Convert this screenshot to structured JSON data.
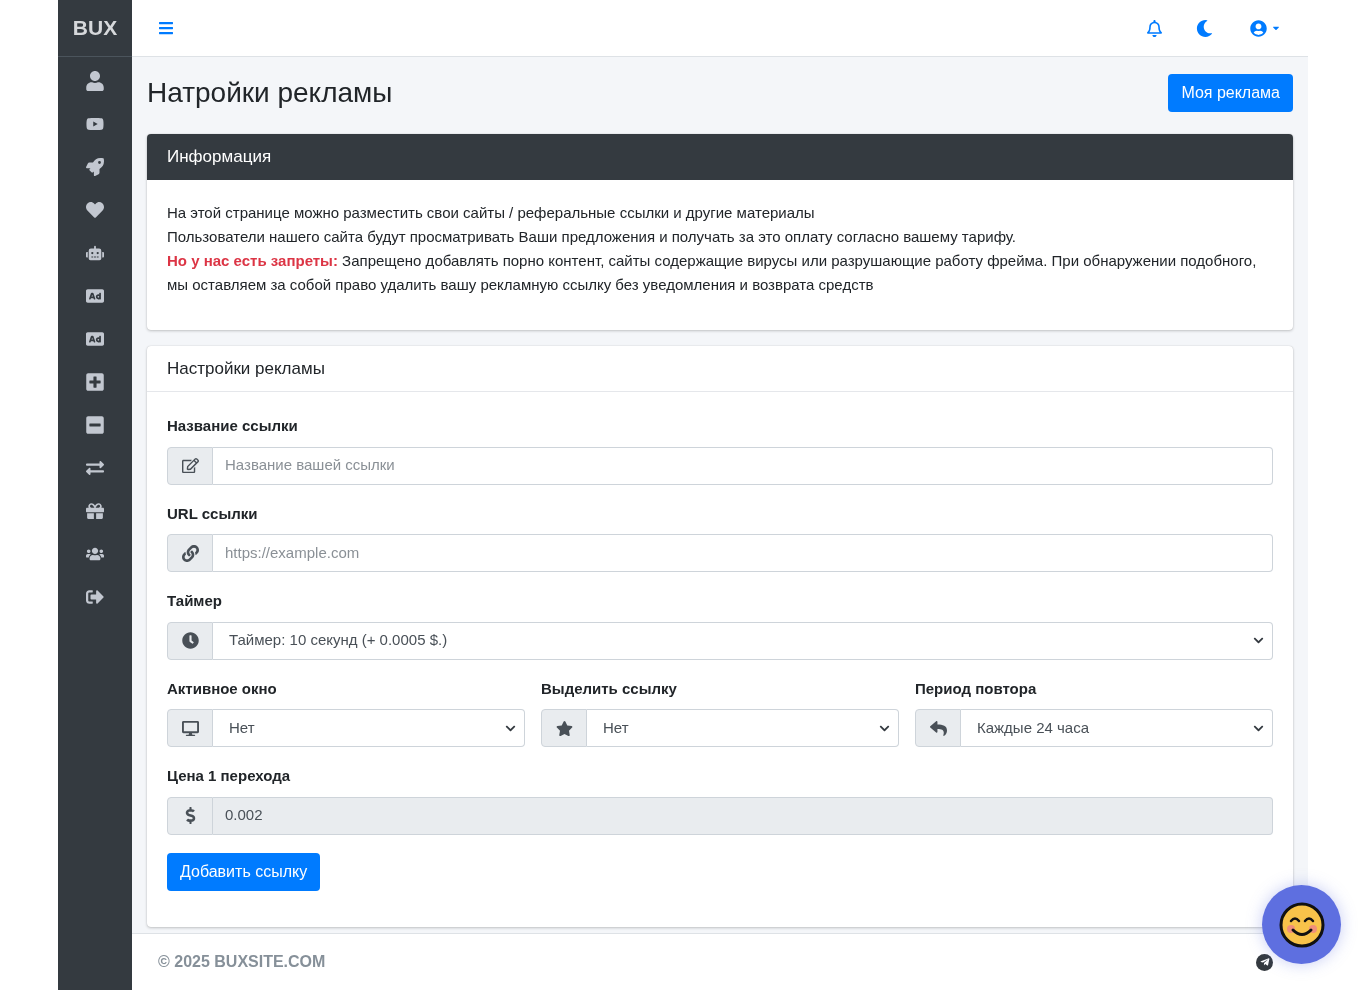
{
  "sidebar": {
    "brand": "BUX"
  },
  "page": {
    "title": "Натройки рекламы",
    "action_button": "Моя реклама"
  },
  "info_card": {
    "title": "Информация",
    "lines": [
      "На этой странице можно разместить свои сайты / реферальные ссылки и другие материалы",
      "Пользователи нашего сайта будут просматривать Ваши предложения и получать за это оплату согласно вашему тарифу.",
      "**Но у нас есть запреты:** Запрещено добавлять порно контент, сайты содержащие вирусы или разрушающие работу фрейма. При обнаружении подобного, мы оставляем за собой право удалить вашу рекламную ссылку без уведомления и возврата средств"
    ]
  },
  "settings_card": {
    "title": "Настройки рекламы",
    "rows": [
      {
        "fields": [
          {
            "kind": "input",
            "label": "Название ссылки",
            "placeholder": "Название вашей ссылки",
            "disabled": false
          }
        ]
      },
      {
        "fields": [
          {
            "kind": "input",
            "label": "URL ссылки",
            "placeholder": "https://example.com",
            "disabled": false
          }
        ]
      },
      {
        "fields": [
          {
            "kind": "select",
            "label": "Таймер",
            "value": "Таймер: 10 секунд (+ 0.0005 $.)",
            "disabled": false
          }
        ]
      },
      {
        "fields": [
          {
            "kind": "select",
            "label": "Активное окно",
            "value": "Нет",
            "disabled": false
          },
          {
            "kind": "select",
            "label": "Выделить ссылку",
            "value": "Нет",
            "disabled": false
          },
          {
            "kind": "select",
            "label": "Период повтора",
            "value": "Каждые 24 часа",
            "disabled": false
          }
        ]
      },
      {
        "fields": [
          {
            "kind": "input",
            "label": "Цена 1 перехода",
            "value": "0.002",
            "disabled": true
          }
        ]
      }
    ],
    "submit_button": "Добавить ссылку"
  },
  "footer": {
    "copyright": "© 2025 BUXSITE.COM"
  }
}
